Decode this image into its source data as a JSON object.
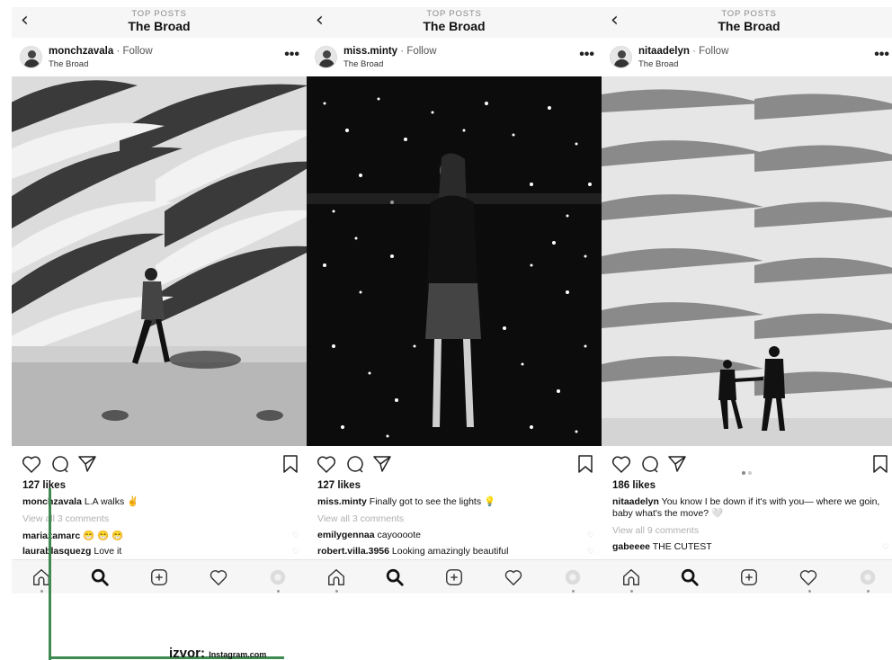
{
  "top_label": "TOP POSTS",
  "page_title": "The Broad",
  "follow_label": "Follow",
  "separator": "·",
  "more_label": "•••",
  "posts": [
    {
      "username": "monchzavala",
      "location": "The Broad",
      "photo": "grayscale photo of woman walking past the honeycomb facade of The Broad",
      "likes": "127 likes",
      "caption": "L.A walks ✌",
      "view_all": "View all 3 comments",
      "comments": [
        {
          "user": "mariazamarc",
          "text": "😁 😁 😁"
        },
        {
          "user": "laurablasquezg",
          "text": "Love it"
        }
      ],
      "carousel": false
    },
    {
      "username": "miss.minty",
      "location": "The Broad",
      "photo": "grayscale photo of woman in infinity mirror room with lights",
      "likes": "127 likes",
      "caption": "Finally got to see the lights 💡",
      "view_all": "View all 3 comments",
      "comments": [
        {
          "user": "emilygennaa",
          "text": "cayoooote"
        },
        {
          "user": "robert.villa.3956",
          "text": "Looking amazingly beautiful"
        }
      ],
      "carousel": false
    },
    {
      "username": "nitaadelyn",
      "location": "The Broad",
      "photo": "grayscale photo of couple holding hands in front of The Broad facade",
      "likes": "186 likes",
      "caption": "You know I be down if it's with you— where we goin, baby what's the move? 🤍",
      "view_all": "View all 9 comments",
      "comments": [
        {
          "user": "gabeeee",
          "text": "THE CUTEST"
        }
      ],
      "carousel": true
    }
  ],
  "credit": {
    "brand": "izvor:",
    "site": "Instagram.com"
  },
  "colors": {
    "bracket": "#3f8a50",
    "bar_bg": "#f6f6f6",
    "muted": "#b0b0b0"
  },
  "icons": [
    "back-chevron-icon",
    "more-icon",
    "heart-icon",
    "comment-icon",
    "share-icon",
    "bookmark-icon",
    "home-icon",
    "search-icon",
    "new-post-icon",
    "activity-heart-icon",
    "profile-icon"
  ]
}
